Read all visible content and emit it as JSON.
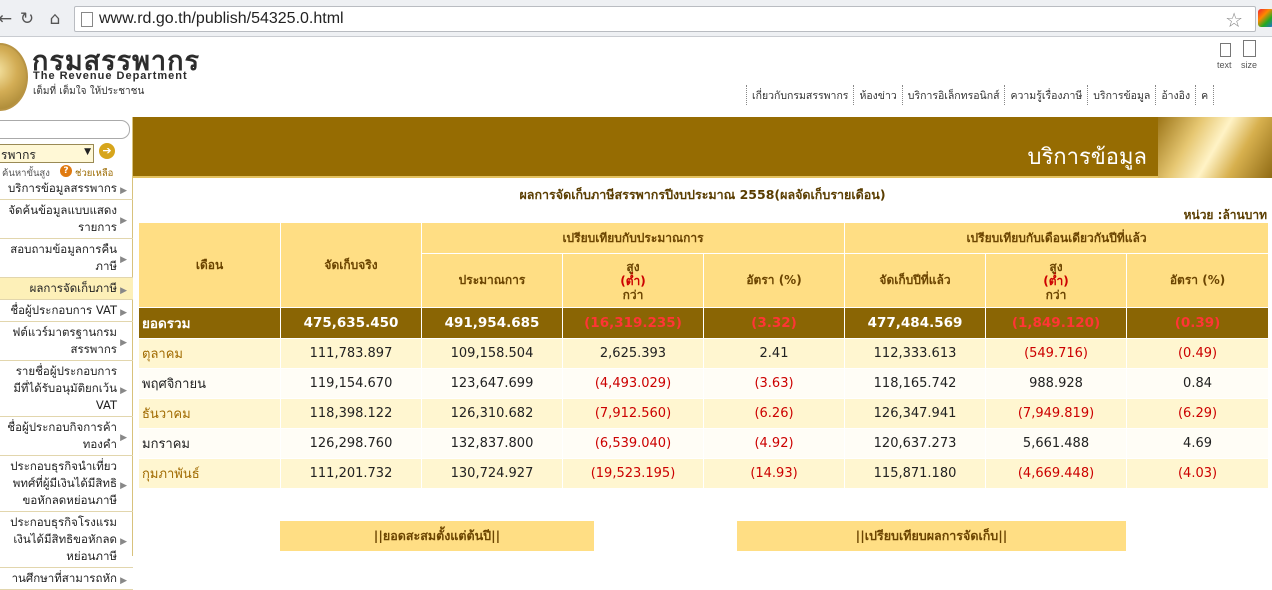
{
  "browser": {
    "url": "www.rd.go.th/publish/54325.0.html",
    "icons": [
      "back-arrow-icon",
      "reload-icon",
      "home-icon",
      "page-icon",
      "star-icon",
      "extension-icon"
    ]
  },
  "header": {
    "brand_th": "กรมสรรพากร",
    "brand_en": "The Revenue Department",
    "slogan": "เต็มที่ เต็มใจ ให้ประชาชน",
    "textsize_text": "text",
    "textsize_size": "size",
    "topnav": [
      "เกี่ยวกับกรมสรรพากร",
      "ห้องข่าว",
      "บริการอิเล็กทรอนิกส์",
      "ความรู้เรื่องภาษี",
      "บริการข้อมูล",
      "อ้างอิง",
      "ค"
    ]
  },
  "sidebar": {
    "select_value": "รพากร",
    "advanced_search": "ค้นหาขั้นสูง",
    "help": "ช่วยเหลือ",
    "items": [
      {
        "lines": [
          "บริการข้อมูลสรรพากร"
        ]
      },
      {
        "lines": [
          "จัดค้นข้อมูลแบบแสดง",
          "รายการ"
        ]
      },
      {
        "lines": [
          "สอบถามข้อมูลการคืน",
          "ภาษี"
        ]
      },
      {
        "lines": [
          "ผลการจัดเก็บภาษี"
        ],
        "active": true
      },
      {
        "lines": [
          "ชื่อผู้ประกอบการ VAT"
        ]
      },
      {
        "lines": [
          "ฟต์แวร์มาตรฐานกรม",
          "สรรพากร"
        ]
      },
      {
        "lines": [
          "รายชื่อผู้ประกอบการ",
          "มีที่ได้รับอนุมัติยกเว้น",
          "VAT"
        ]
      },
      {
        "lines": [
          "ชื่อผู้ประกอบกิจการค้า",
          "ทองคำ"
        ]
      },
      {
        "lines": [
          "ประกอบธุรกิจนำเที่ยว",
          "พทศ์ที่ผู้มีเงินได้มีสิทธิ",
          "ขอหักลดหย่อนภาษี"
        ]
      },
      {
        "lines": [
          "ประกอบธุรกิจโรงแรม",
          "เงินได้มีสิทธิขอหักลด",
          "หย่อนภาษี"
        ]
      },
      {
        "lines": [
          "านศึกษาที่สามารถหัก"
        ]
      }
    ]
  },
  "banner": {
    "title": "บริการข้อมูล"
  },
  "report": {
    "title": "ผลการจัดเก็บภาษีสรรพากรปีงบประมาณ 2558(ผลจัดเก็บรายเดือน)",
    "unit": "หน่วย :ล้านบาท",
    "headers": {
      "month": "เดือน",
      "actual": "จัดเก็บจริง",
      "group_budget": "เปรียบเทียบกับประมาณการ",
      "group_lastyear": "เปรียบเทียบกับเดือนเดียวกันปีที่แล้ว",
      "budget": "ประมาณการ",
      "high": "สูง",
      "low": "(ต่ำ)",
      "than": "กว่า",
      "rate": "อัตรา (%)",
      "last_year": "จัดเก็บปีที่แล้ว"
    },
    "total": {
      "label": "ยอดรวม",
      "actual": "475,635.450",
      "budget": "491,954.685",
      "diff_budget": "(16,319.235)",
      "rate_budget": "(3.32)",
      "last_year": "477,484.569",
      "diff_last": "(1,849.120)",
      "rate_last": "(0.39)"
    },
    "rows": [
      {
        "month": "ตุลาคม",
        "actual": "111,783.897",
        "budget": "109,158.504",
        "diff_budget": "2,625.393",
        "rate_budget": "2.41",
        "last_year": "112,333.613",
        "diff_last": "(549.716)",
        "rate_last": "(0.49)"
      },
      {
        "month": "พฤศจิกายน",
        "actual": "119,154.670",
        "budget": "123,647.699",
        "diff_budget": "(4,493.029)",
        "rate_budget": "(3.63)",
        "last_year": "118,165.742",
        "diff_last": "988.928",
        "rate_last": "0.84"
      },
      {
        "month": "ธันวาคม",
        "actual": "118,398.122",
        "budget": "126,310.682",
        "diff_budget": "(7,912.560)",
        "rate_budget": "(6.26)",
        "last_year": "126,347.941",
        "diff_last": "(7,949.819)",
        "rate_last": "(6.29)"
      },
      {
        "month": "มกราคม",
        "actual": "126,298.760",
        "budget": "132,837.800",
        "diff_budget": "(6,539.040)",
        "rate_budget": "(4.92)",
        "last_year": "120,637.273",
        "diff_last": "5,661.488",
        "rate_last": "4.69"
      },
      {
        "month": "กุมภาพันธ์",
        "actual": "111,201.732",
        "budget": "130,724.927",
        "diff_budget": "(19,523.195)",
        "rate_budget": "(14.93)",
        "last_year": "115,871.180",
        "diff_last": "(4,669.448)",
        "rate_last": "(4.03)"
      }
    ]
  },
  "buttons": {
    "cumulative": "||ยอดสะสมตั้งแต่ต้นปี||",
    "compare": "||เปรียบเทียบผลการจัดเก็บ||"
  },
  "colors": {
    "banner": "#966c02",
    "header_cell": "#ffde84",
    "total_row": "#8a6504",
    "negative": "#cc0000"
  }
}
